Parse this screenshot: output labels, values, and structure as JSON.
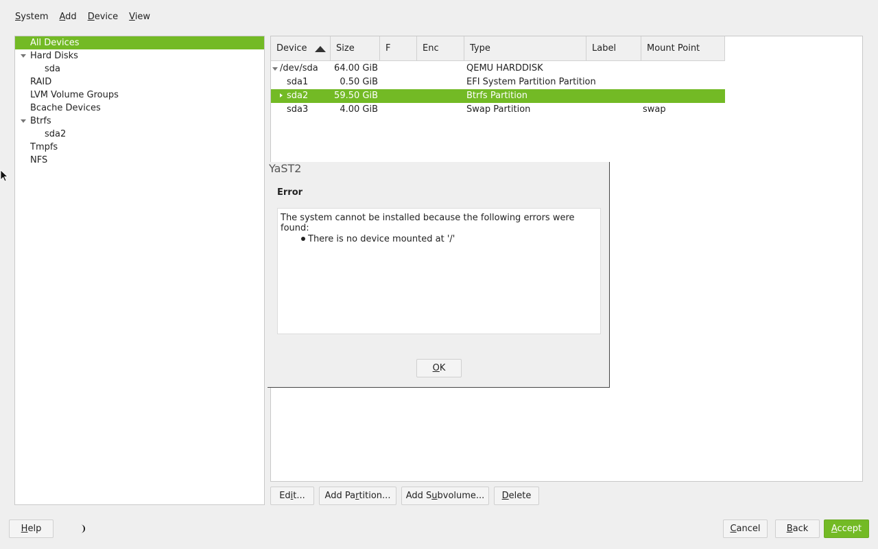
{
  "menubar": {
    "items": [
      {
        "pre": "",
        "acc": "S",
        "post": "ystem"
      },
      {
        "pre": "",
        "acc": "A",
        "post": "dd"
      },
      {
        "pre": "",
        "acc": "D",
        "post": "evice"
      },
      {
        "pre": "",
        "acc": "V",
        "post": "iew"
      }
    ]
  },
  "tree": {
    "items": [
      {
        "label": "All Devices"
      },
      {
        "label": "Hard Disks"
      },
      {
        "label": "sda"
      },
      {
        "label": "RAID"
      },
      {
        "label": "LVM Volume Groups"
      },
      {
        "label": "Bcache Devices"
      },
      {
        "label": "Btrfs"
      },
      {
        "label": "sda2"
      },
      {
        "label": "Tmpfs"
      },
      {
        "label": "NFS"
      }
    ]
  },
  "table": {
    "columns": [
      "Device",
      "Size",
      "F",
      "Enc",
      "Type",
      "Label",
      "Mount Point"
    ],
    "rows": [
      {
        "device": "/dev/sda",
        "size": "64.00 GiB",
        "f": "",
        "enc": "",
        "type": "QEMU HARDDISK",
        "label": "",
        "mount": ""
      },
      {
        "device": "sda1",
        "size": "0.50 GiB",
        "f": "",
        "enc": "",
        "type": "EFI System Partition Partition",
        "label": "",
        "mount": ""
      },
      {
        "device": "sda2",
        "size": "59.50 GiB",
        "f": "",
        "enc": "",
        "type": "Btrfs Partition",
        "label": "",
        "mount": ""
      },
      {
        "device": "sda3",
        "size": "4.00 GiB",
        "f": "",
        "enc": "",
        "type": "Swap Partition",
        "label": "",
        "mount": "swap"
      }
    ]
  },
  "dialog": {
    "title": "YaST2",
    "heading": "Error",
    "message": "The system cannot be installed because the following errors were found:",
    "bullet": "There is no device mounted at '/'",
    "ok": {
      "pre": "",
      "acc": "O",
      "post": "K"
    }
  },
  "actions": {
    "edit": {
      "pre": "Ed",
      "acc": "i",
      "post": "t..."
    },
    "add_partition": {
      "pre": "Add Pa",
      "acc": "r",
      "post": "tition..."
    },
    "add_subvolume": {
      "pre": "Add S",
      "acc": "u",
      "post": "bvolume..."
    },
    "delete": {
      "pre": "",
      "acc": "D",
      "post": "elete"
    }
  },
  "footer": {
    "help": {
      "pre": "",
      "acc": "H",
      "post": "elp"
    },
    "cancel": {
      "pre": "",
      "acc": "C",
      "post": "ancel"
    },
    "back": {
      "pre": "",
      "acc": "B",
      "post": "ack"
    },
    "accept": {
      "pre": "",
      "acc": "A",
      "post": "ccept"
    }
  },
  "colors": {
    "accent": "#73ba25",
    "background": "#efefef"
  },
  "icons": [
    "sort-ascending-icon",
    "expand-arrow-icon",
    "collapse-arrow-icon",
    "moon-icon",
    "mouse-cursor-icon"
  ]
}
